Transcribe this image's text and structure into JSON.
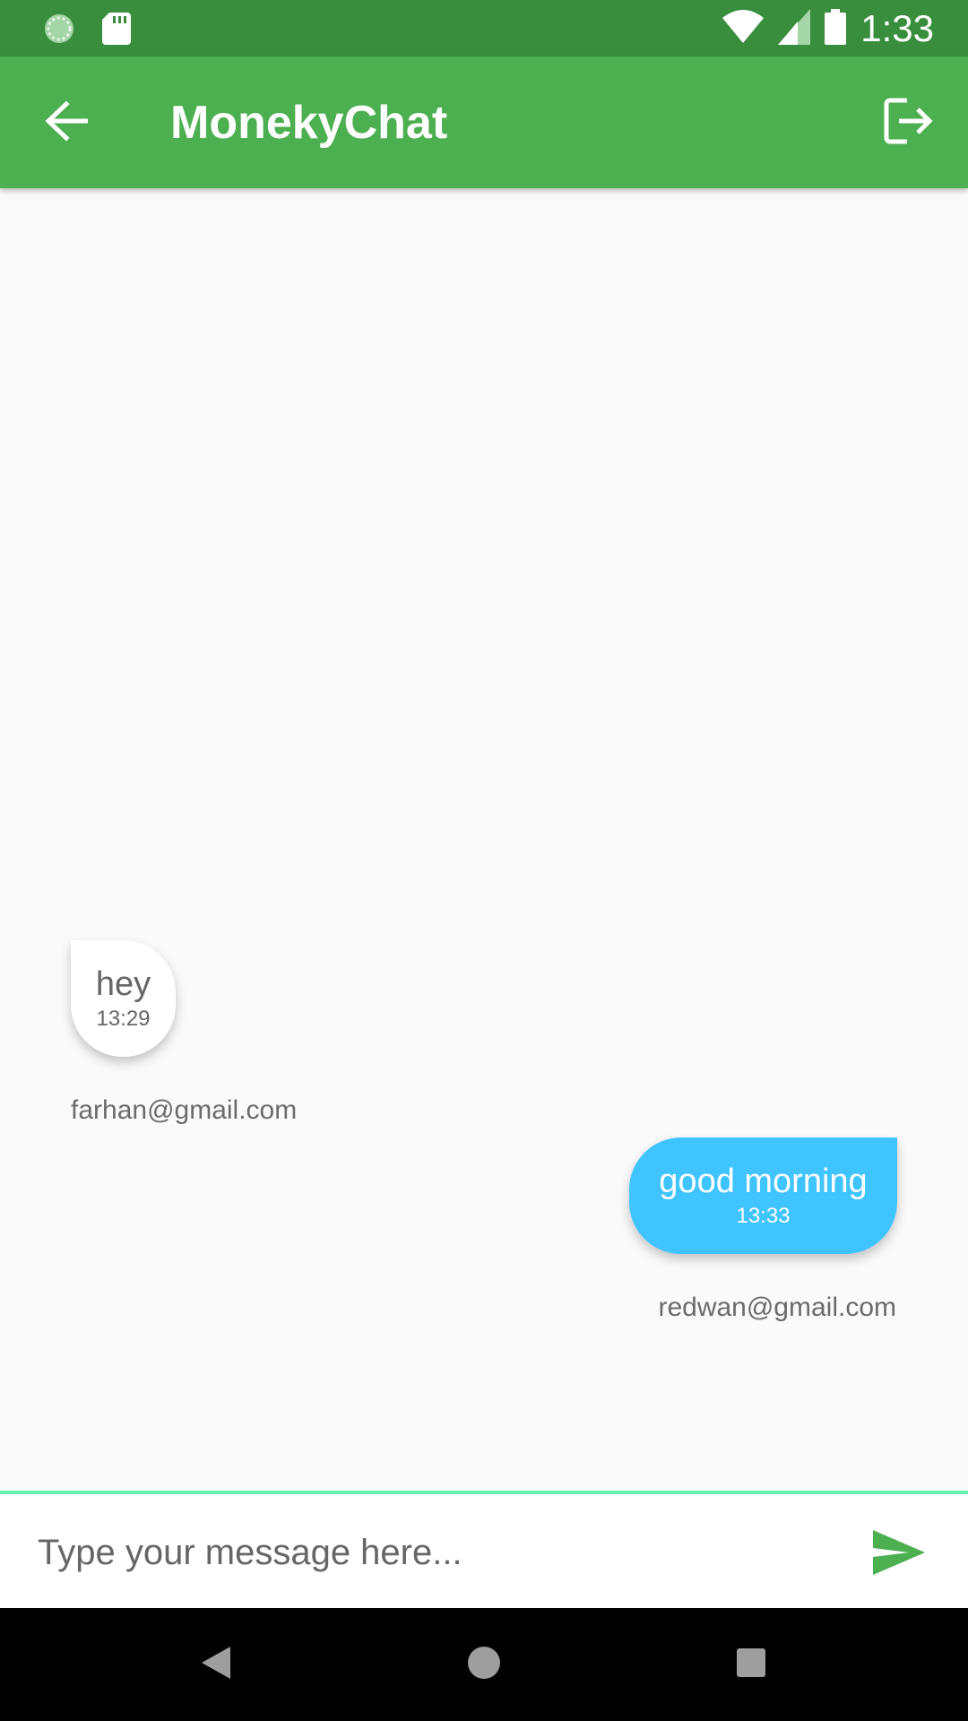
{
  "status_bar": {
    "time": "1:33",
    "icons": [
      "loading-icon",
      "sd-card-icon",
      "wifi-icon",
      "signal-icon",
      "battery-icon"
    ]
  },
  "app_bar": {
    "title": "MonekyChat",
    "back_icon": "arrow-back-icon",
    "logout_icon": "logout-icon",
    "background_color": "#4caf50",
    "status_bar_color": "#388e3c"
  },
  "messages": [
    {
      "sender": "farhan@gmail.com",
      "text": "hey",
      "time": "13:29",
      "side": "left",
      "bubble_color": "#ffffff"
    },
    {
      "sender": "redwan@gmail.com",
      "text": "good morning",
      "time": "13:33",
      "side": "right",
      "bubble_color": "#40c4ff"
    }
  ],
  "composer": {
    "placeholder": "Type your message here...",
    "value": "",
    "send_icon": "send-icon",
    "border_color": "#69f0ae",
    "send_color": "#4caf50"
  },
  "nav_bar": {
    "buttons": [
      "nav-back-icon",
      "nav-home-icon",
      "nav-recents-icon"
    ]
  }
}
